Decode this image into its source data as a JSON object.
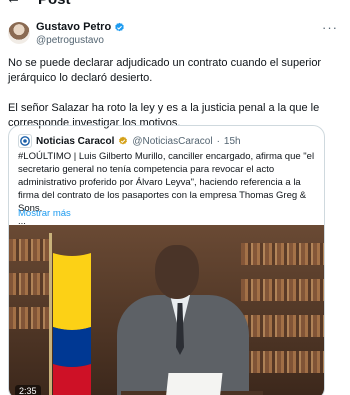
{
  "header": {
    "title": "Post",
    "back_icon": "arrow-left-icon"
  },
  "author": {
    "name": "Gustavo Petro",
    "handle": "@petrogustavo",
    "verified_color": "#1d9bf0"
  },
  "tweet": {
    "paragraphs": [
      "No se puede declarar adjudicado un contrato cuando el superior jerárquico lo declaró desierto.",
      "El señor Salazar ha roto la ley y es a la justicia penal a la que le corresponde investigar los motivos."
    ]
  },
  "quote": {
    "name": "Noticias Caracol",
    "handle": "@NoticiasCaracol",
    "separator": "·",
    "time": "15h",
    "text": "#LOÚLTIMO | Luis Gilberto Murillo, canciller encargado, afirma que \"el secretario general no tenía competencia para revocar el acto administrativo proferido por Álvaro Leyva\", haciendo referencia a la firma del contrato de los pasaportes con la empresa Thomas Greg & Sons.",
    "ellipsis": "...",
    "show_more": "Mostrar más",
    "video_time": "2:35"
  },
  "colors": {
    "link": "#1d9bf0",
    "muted": "#536471",
    "border": "#cfd9de"
  }
}
